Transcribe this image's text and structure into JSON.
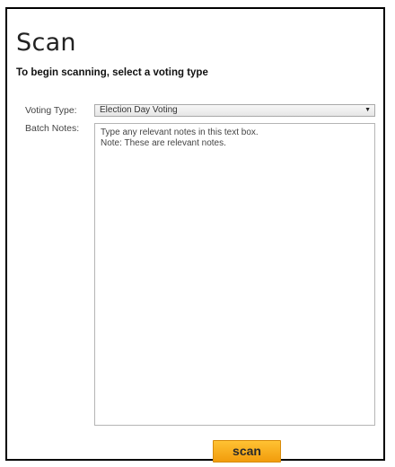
{
  "page": {
    "title": "Scan",
    "subtitle": "To begin scanning, select a voting type"
  },
  "form": {
    "voting_type_label": "Voting Type:",
    "voting_type_value": "Election Day Voting",
    "batch_notes_label": "Batch Notes:",
    "batch_notes_text": "Type any relevant notes in this text box.\nNote: These are relevant notes."
  },
  "actions": {
    "scan_label": "scan"
  },
  "colors": {
    "scan_button": "#f5a614",
    "frame_border": "#000000"
  }
}
